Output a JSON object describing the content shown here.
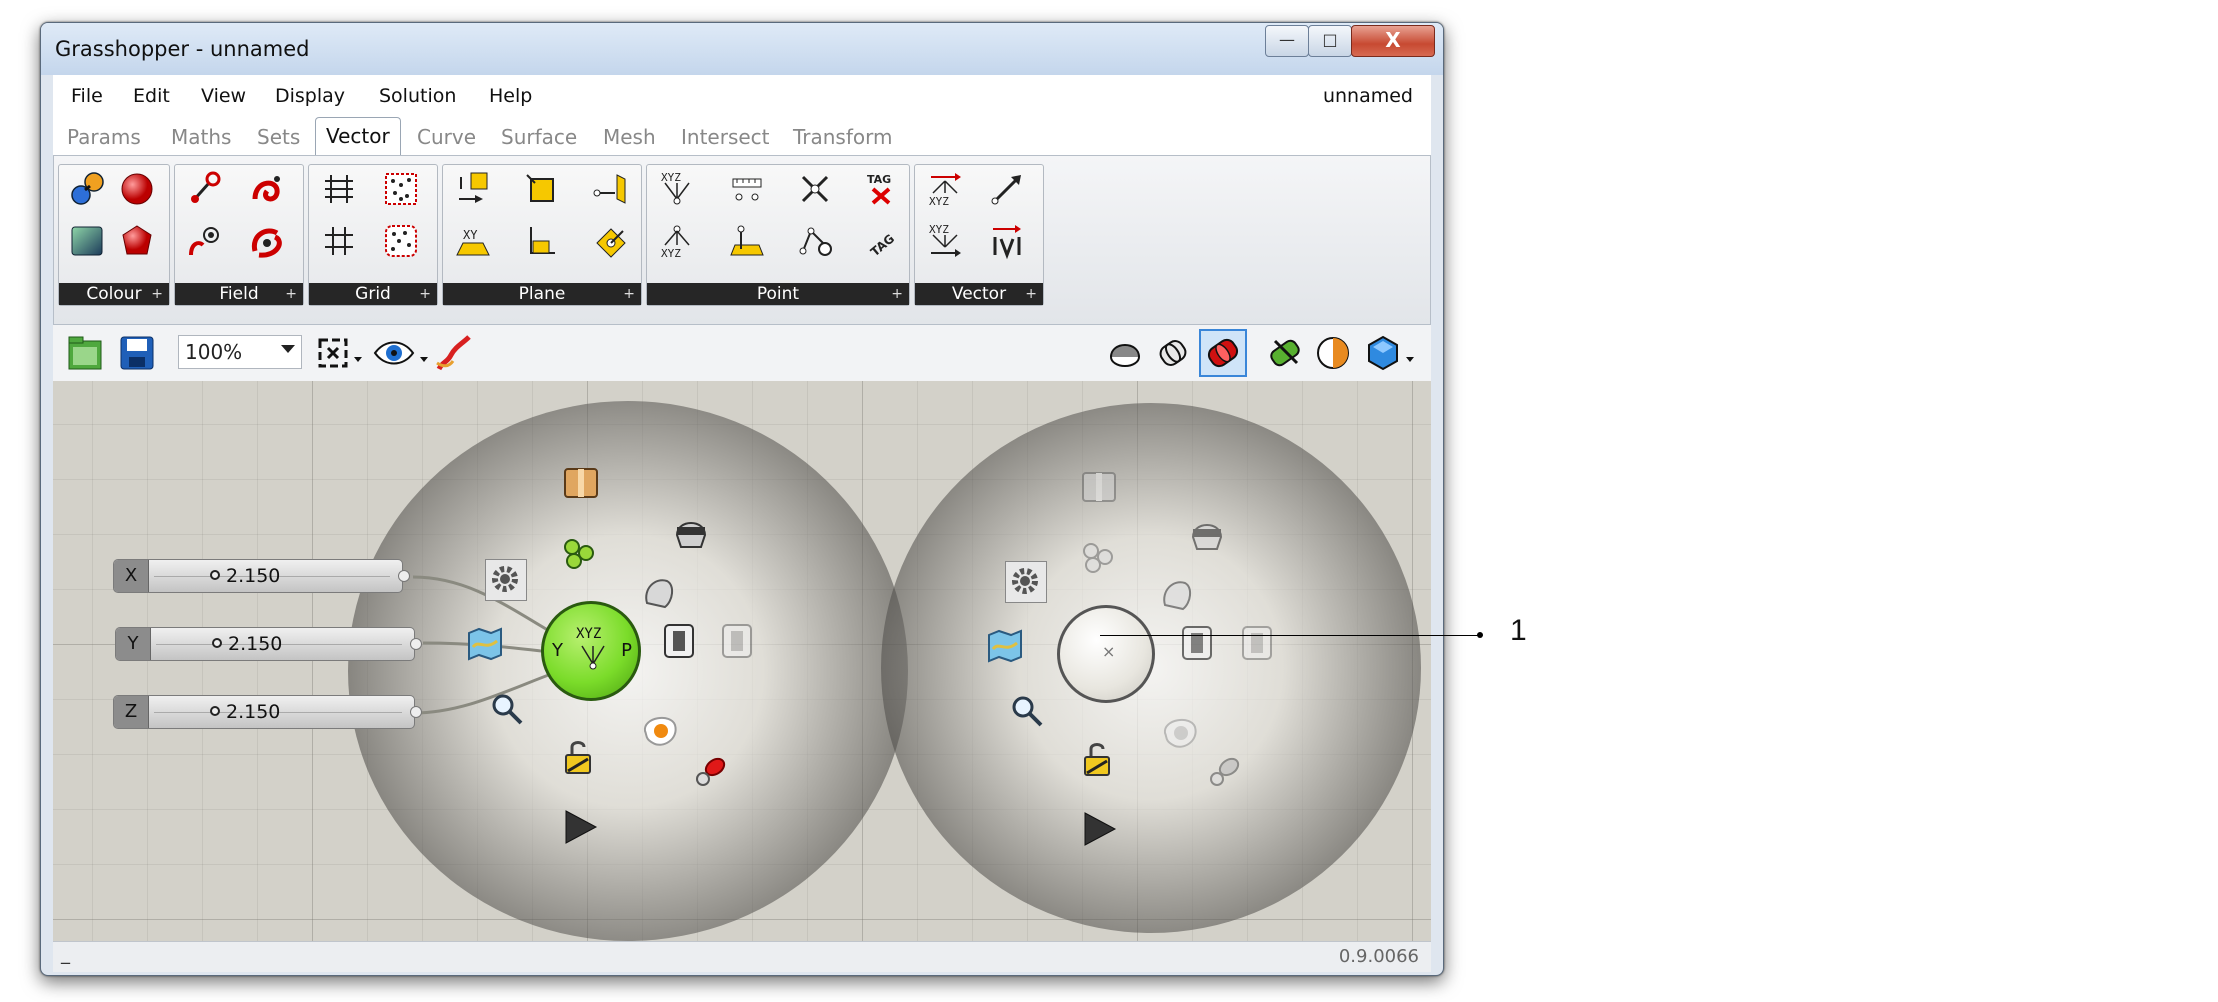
{
  "window": {
    "title": "Grasshopper - unnamed",
    "minimize_glyph": "—",
    "maximize_glyph": "□",
    "close_glyph": "X"
  },
  "menubar": {
    "items": [
      "File",
      "Edit",
      "View",
      "Display",
      "Solution",
      "Help"
    ],
    "document_name": "unnamed"
  },
  "tabs": {
    "items": [
      "Params",
      "Maths",
      "Sets",
      "Vector",
      "Curve",
      "Surface",
      "Mesh",
      "Intersect",
      "Transform"
    ],
    "active": "Vector"
  },
  "ribbon": {
    "groups": [
      "Colour",
      "Field",
      "Grid",
      "Plane",
      "Point",
      "Vector"
    ],
    "expand_glyph": "+",
    "icon_text": {
      "xyz": "XYZ",
      "xy": "XY",
      "tag": "TAG"
    }
  },
  "toolbar": {
    "zoom": "100%"
  },
  "canvas": {
    "sliders": [
      {
        "name": "X",
        "value": "2.150"
      },
      {
        "name": "Y",
        "value": "2.150"
      },
      {
        "name": "Z",
        "value": "2.150"
      }
    ],
    "component_left": {
      "center_label": "XYZ",
      "left_input": "Y",
      "right_output": "P"
    },
    "component_right": {
      "center_mark": "×"
    }
  },
  "status": {
    "left": "_",
    "version": "0.9.0066"
  },
  "callout": {
    "label": "1"
  },
  "colors": {
    "title_bar": "#c4d6ec",
    "canvas": "#d3d1c9",
    "component_green": "#7bdc2a",
    "close_button": "#c74a32"
  }
}
